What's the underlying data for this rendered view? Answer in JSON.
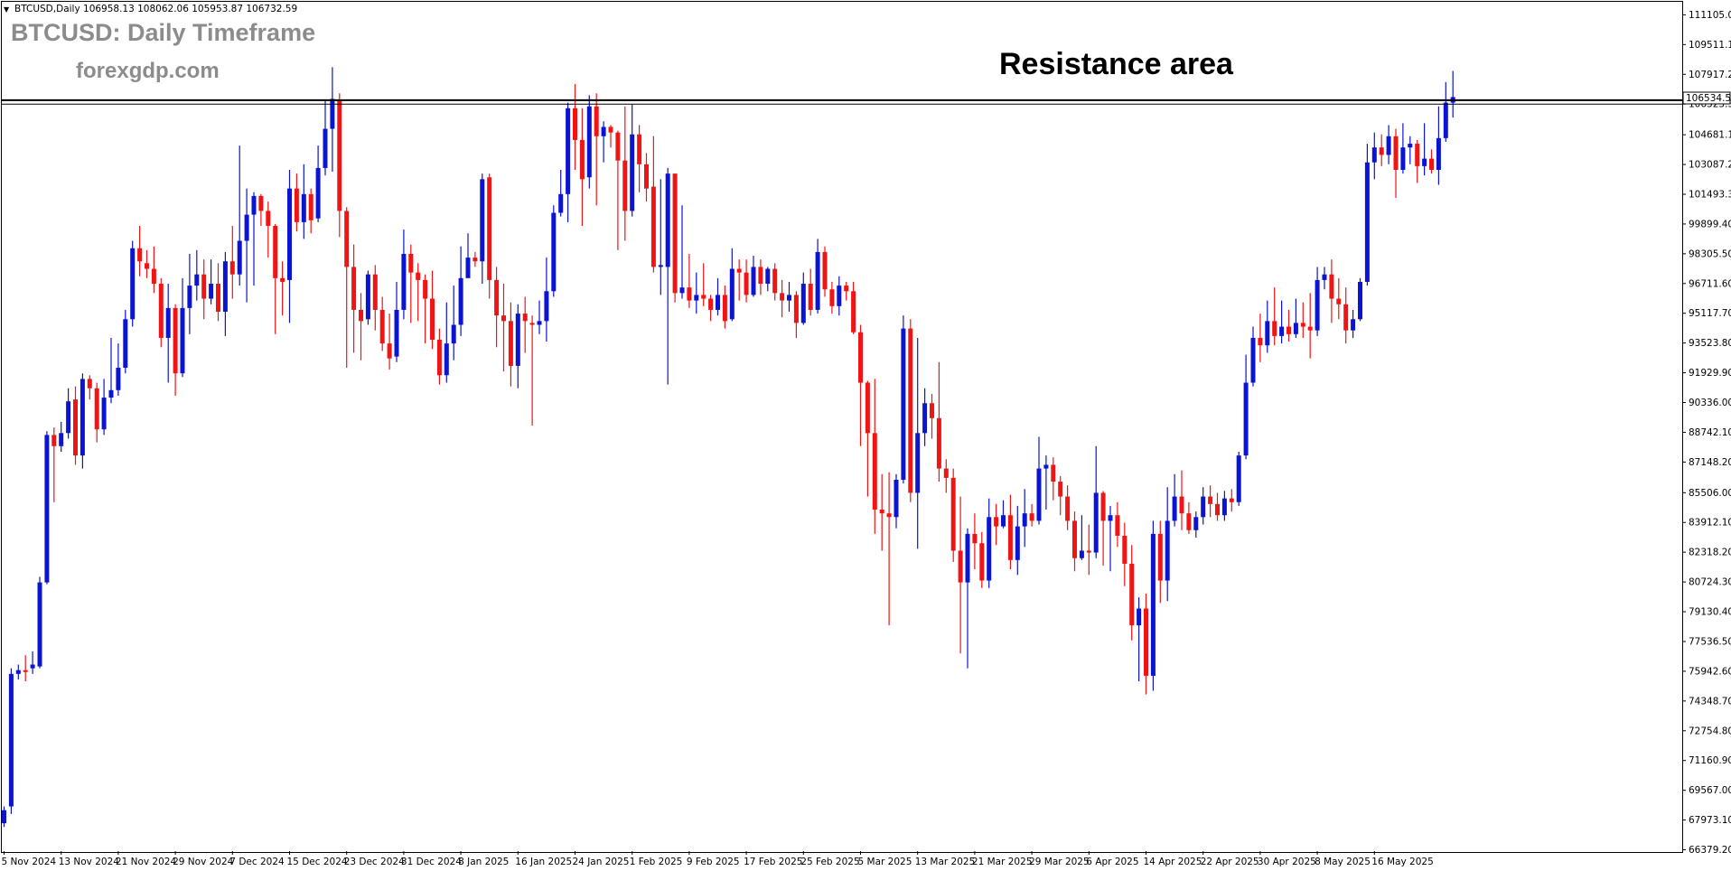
{
  "window": {
    "symbol_info": "BTCUSD,Daily  106958.13 108062.06 105953.87 106732.59",
    "dropdown_glyph": "▼"
  },
  "overlay": {
    "title": "BTCUSD: Daily Timeframe",
    "site": "forexgdp.com",
    "annotation": "Resistance area"
  },
  "colors": {
    "bull": "#0a14d2",
    "bear": "#f01414",
    "background": "#ffffff",
    "resistance_line": "#000000",
    "frame": "#000000"
  },
  "chart_data": {
    "type": "candlestick",
    "ylim": [
      66379.2,
      111105.0
    ],
    "y_ticks": [
      "111105.00",
      "109511.10",
      "107917.20",
      "106323.30",
      "104681.10",
      "103087.20",
      "101493.30",
      "99899.40",
      "98305.50",
      "96711.60",
      "95117.70",
      "93523.80",
      "91929.90",
      "90336.00",
      "88742.10",
      "87148.20",
      "85506.00",
      "83912.10",
      "82318.20",
      "80724.30",
      "79130.40",
      "77536.50",
      "75942.60",
      "74348.70",
      "72754.80",
      "71160.90",
      "69567.00",
      "67973.10",
      "66379.20"
    ],
    "x_labels": [
      "5 Nov 2024",
      "13 Nov 2024",
      "21 Nov 2024",
      "29 Nov 2024",
      "7 Dec 2024",
      "15 Dec 2024",
      "23 Dec 2024",
      "31 Dec 2024",
      "8 Jan 2025",
      "16 Jan 2025",
      "24 Jan 2025",
      "1 Feb 2025",
      "9 Feb 2025",
      "17 Feb 2025",
      "25 Feb 2025",
      "5 Mar 2025",
      "13 Mar 2025",
      "21 Mar 2025",
      "29 Mar 2025",
      "6 Apr 2025",
      "14 Apr 2025",
      "22 Apr 2025",
      "30 Apr 2025",
      "8 May 2025",
      "16 May 2025"
    ],
    "resistance_levels": [
      106534.52,
      106323.3
    ],
    "current_price": "106534.52",
    "candles": [
      [
        67800,
        68500,
        67600,
        68700
      ],
      [
        68700,
        75800,
        68300,
        76100
      ],
      [
        75800,
        76000,
        75500,
        76300
      ],
      [
        76000,
        75900,
        75400,
        76800
      ],
      [
        76100,
        76300,
        75800,
        77000
      ],
      [
        76200,
        80700,
        76100,
        81000
      ],
      [
        80700,
        88600,
        80600,
        88800
      ],
      [
        88600,
        88000,
        85000,
        89000
      ],
      [
        88000,
        88700,
        87700,
        89300
      ],
      [
        88700,
        90400,
        88400,
        91100
      ],
      [
        90500,
        87500,
        87000,
        91200
      ],
      [
        87500,
        91600,
        86800,
        91900
      ],
      [
        91600,
        91100,
        90500,
        91800
      ],
      [
        91100,
        88900,
        88200,
        91400
      ],
      [
        88900,
        90600,
        88600,
        91600
      ],
      [
        90600,
        91000,
        90300,
        93800
      ],
      [
        91000,
        92200,
        90700,
        93500
      ],
      [
        92200,
        94800,
        91900,
        95300
      ],
      [
        94800,
        98600,
        94400,
        99000
      ],
      [
        98600,
        97900,
        97100,
        99800
      ],
      [
        97800,
        97500,
        97000,
        98500
      ],
      [
        97500,
        96700,
        96200,
        98700
      ],
      [
        96700,
        93800,
        93300,
        97000
      ],
      [
        93800,
        95400,
        91400,
        96700
      ],
      [
        95400,
        91900,
        90700,
        95600
      ],
      [
        91900,
        95400,
        91700,
        97000
      ],
      [
        95400,
        96600,
        94000,
        98300
      ],
      [
        96600,
        97200,
        95800,
        98500
      ],
      [
        97200,
        95900,
        94800,
        98000
      ],
      [
        95900,
        96700,
        95600,
        98000
      ],
      [
        96700,
        95200,
        94700,
        97800
      ],
      [
        95200,
        97900,
        93900,
        98400
      ],
      [
        97900,
        97200,
        95900,
        99800
      ],
      [
        97200,
        99000,
        96600,
        104100
      ],
      [
        99000,
        100400,
        95700,
        101800
      ],
      [
        100400,
        101400,
        96600,
        101600
      ],
      [
        101400,
        100600,
        99800,
        101500
      ],
      [
        100600,
        99800,
        98100,
        101100
      ],
      [
        99800,
        97000,
        94000,
        99900
      ],
      [
        97000,
        96800,
        95000,
        97900
      ],
      [
        96900,
        101800,
        94600,
        102800
      ],
      [
        101800,
        100000,
        99500,
        102600
      ],
      [
        100000,
        101500,
        99100,
        103100
      ],
      [
        101500,
        100100,
        99400,
        101800
      ],
      [
        100200,
        102900,
        100000,
        104100
      ],
      [
        102900,
        105000,
        102500,
        106500
      ],
      [
        105000,
        106600,
        102700,
        108300
      ],
      [
        106500,
        100600,
        99200,
        106900
      ],
      [
        100600,
        97600,
        92200,
        100800
      ],
      [
        97600,
        95300,
        93000,
        98800
      ],
      [
        95300,
        94700,
        92600,
        96200
      ],
      [
        94800,
        97200,
        94500,
        97400
      ],
      [
        97200,
        95300,
        94200,
        97700
      ],
      [
        95300,
        93500,
        93100,
        96000
      ],
      [
        93500,
        92700,
        92100,
        95100
      ],
      [
        92800,
        95300,
        92500,
        96800
      ],
      [
        95300,
        98300,
        94800,
        99600
      ],
      [
        98300,
        97300,
        94600,
        98800
      ],
      [
        97300,
        96900,
        94700,
        97800
      ],
      [
        96900,
        95900,
        93500,
        97200
      ],
      [
        95900,
        93700,
        93200,
        97400
      ],
      [
        93700,
        91800,
        91300,
        94300
      ],
      [
        91800,
        93500,
        91400,
        95700
      ],
      [
        93500,
        94500,
        92600,
        96600
      ],
      [
        94500,
        97000,
        93900,
        98700
      ],
      [
        97000,
        98100,
        97200,
        99400
      ],
      [
        98100,
        97900,
        97600,
        98400
      ],
      [
        97900,
        102300,
        96700,
        102600
      ],
      [
        102400,
        96900,
        95900,
        102600
      ],
      [
        96900,
        95000,
        93300,
        97600
      ],
      [
        95000,
        94700,
        92000,
        96700
      ],
      [
        94700,
        92300,
        91200,
        95700
      ],
      [
        92300,
        95100,
        91100,
        95600
      ],
      [
        95100,
        94700,
        93000,
        96000
      ],
      [
        94600,
        94500,
        89100,
        95000
      ],
      [
        94500,
        94700,
        94000,
        95800
      ],
      [
        94700,
        96300,
        93600,
        98100
      ],
      [
        96300,
        100500,
        96000,
        100900
      ],
      [
        100500,
        101500,
        100300,
        102800
      ],
      [
        101500,
        106100,
        100000,
        106400
      ],
      [
        106100,
        104400,
        102800,
        107400
      ],
      [
        104400,
        102300,
        99800,
        106100
      ],
      [
        102400,
        106200,
        101800,
        106800
      ],
      [
        106200,
        104600,
        100900,
        106900
      ],
      [
        104600,
        105100,
        103200,
        105400
      ],
      [
        105100,
        104800,
        104000,
        105200
      ],
      [
        104800,
        103300,
        98500,
        104900
      ],
      [
        103300,
        100600,
        99000,
        106200
      ],
      [
        100600,
        104700,
        100300,
        106300
      ],
      [
        104700,
        103100,
        101600,
        105200
      ],
      [
        103100,
        101800,
        101100,
        103700
      ],
      [
        101900,
        97600,
        97300,
        104600
      ],
      [
        97600,
        97700,
        96100,
        102300
      ],
      [
        97600,
        102600,
        91300,
        102900
      ],
      [
        102600,
        96200,
        95700,
        102200
      ],
      [
        96200,
        96500,
        95900,
        100900
      ],
      [
        96500,
        95800,
        95400,
        98300
      ],
      [
        95800,
        96100,
        95100,
        97300
      ],
      [
        96100,
        95900,
        95500,
        97800
      ],
      [
        95900,
        95300,
        94700,
        96100
      ],
      [
        95300,
        96100,
        95000,
        97000
      ],
      [
        96100,
        94700,
        94300,
        96600
      ],
      [
        94800,
        97500,
        94700,
        98600
      ],
      [
        97500,
        97300,
        95800,
        98000
      ],
      [
        97300,
        96100,
        95700,
        98000
      ],
      [
        96100,
        97600,
        96000,
        98200
      ],
      [
        97600,
        96700,
        96100,
        98000
      ],
      [
        96700,
        97500,
        96300,
        97600
      ],
      [
        97500,
        96200,
        95800,
        97800
      ],
      [
        96200,
        95800,
        94900,
        96900
      ],
      [
        95800,
        96100,
        95200,
        96800
      ],
      [
        96100,
        94600,
        93800,
        96300
      ],
      [
        94600,
        96700,
        94500,
        97300
      ],
      [
        96700,
        95300,
        95000,
        97500
      ],
      [
        95300,
        98400,
        95100,
        99100
      ],
      [
        98400,
        96400,
        96000,
        98700
      ],
      [
        96400,
        95500,
        95100,
        96800
      ],
      [
        95500,
        96600,
        95000,
        97100
      ],
      [
        96600,
        96300,
        95800,
        96800
      ],
      [
        96300,
        94100,
        94000,
        96800
      ],
      [
        94100,
        91400,
        88000,
        94500
      ],
      [
        91400,
        88700,
        85300,
        91500
      ],
      [
        88700,
        84600,
        83300,
        91600
      ],
      [
        84600,
        84400,
        82400,
        86500
      ],
      [
        84400,
        84200,
        78400,
        86600
      ],
      [
        84200,
        86200,
        83600,
        86500
      ],
      [
        86200,
        94300,
        86000,
        95000
      ],
      [
        94300,
        85500,
        85000,
        94800
      ],
      [
        85500,
        88700,
        82500,
        93800
      ],
      [
        88700,
        90300,
        88000,
        91100
      ],
      [
        90300,
        89500,
        88400,
        90800
      ],
      [
        89500,
        86800,
        86100,
        92500
      ],
      [
        86800,
        86300,
        85500,
        87300
      ],
      [
        86300,
        82400,
        81800,
        86800
      ],
      [
        82400,
        80700,
        76900,
        85300
      ],
      [
        80700,
        83300,
        76100,
        83600
      ],
      [
        83300,
        82800,
        81400,
        84400
      ],
      [
        82800,
        80800,
        80400,
        83400
      ],
      [
        80800,
        84200,
        80400,
        85200
      ],
      [
        84200,
        83700,
        82700,
        84900
      ],
      [
        83700,
        84300,
        83600,
        85100
      ],
      [
        84300,
        81900,
        81400,
        85400
      ],
      [
        81900,
        83700,
        81100,
        84800
      ],
      [
        83700,
        84400,
        82600,
        85700
      ],
      [
        84400,
        84000,
        83700,
        84900
      ],
      [
        84000,
        86800,
        83800,
        88500
      ],
      [
        86800,
        87000,
        84600,
        87500
      ],
      [
        87000,
        86100,
        85100,
        87400
      ],
      [
        86100,
        85300,
        84300,
        86400
      ],
      [
        85300,
        84000,
        83500,
        85900
      ],
      [
        84000,
        82000,
        81300,
        84500
      ],
      [
        82000,
        82400,
        81900,
        84300
      ],
      [
        82400,
        82300,
        81100,
        83800
      ],
      [
        82300,
        85500,
        82000,
        88000
      ],
      [
        85500,
        84000,
        81600,
        85600
      ],
      [
        84000,
        84300,
        81300,
        84800
      ],
      [
        84300,
        83200,
        82600,
        85000
      ],
      [
        83200,
        81700,
        80500,
        83900
      ],
      [
        81700,
        78400,
        77600,
        82700
      ],
      [
        78400,
        79300,
        75400,
        79900
      ],
      [
        79300,
        75700,
        74700,
        80100
      ],
      [
        75700,
        83300,
        74900,
        84000
      ],
      [
        83300,
        80800,
        79600,
        84000
      ],
      [
        80800,
        84000,
        79700,
        85800
      ],
      [
        84000,
        85300,
        83700,
        86500
      ],
      [
        85300,
        84400,
        83500,
        86700
      ],
      [
        84400,
        83500,
        83300,
        85000
      ],
      [
        83500,
        84200,
        83100,
        84500
      ],
      [
        84200,
        85300,
        83800,
        85800
      ],
      [
        85300,
        84900,
        84200,
        85900
      ],
      [
        84900,
        84300,
        84000,
        85500
      ],
      [
        84300,
        85200,
        84000,
        85600
      ],
      [
        85200,
        85000,
        84500,
        85700
      ],
      [
        85000,
        87500,
        84800,
        87700
      ],
      [
        87500,
        91400,
        87300,
        92900
      ],
      [
        91400,
        93800,
        91200,
        94400
      ],
      [
        93800,
        93400,
        92500,
        95100
      ],
      [
        93400,
        94700,
        93000,
        95800
      ],
      [
        94700,
        93900,
        93400,
        96500
      ],
      [
        93900,
        94400,
        93500,
        95800
      ],
      [
        94400,
        94000,
        93600,
        95300
      ],
      [
        94000,
        94600,
        93800,
        95900
      ],
      [
        94600,
        94400,
        93800,
        95700
      ],
      [
        94400,
        94200,
        92700,
        96200
      ],
      [
        94200,
        96900,
        93900,
        97600
      ],
      [
        96900,
        97200,
        96400,
        97600
      ],
      [
        97200,
        95900,
        94600,
        98000
      ],
      [
        95900,
        95600,
        94800,
        97000
      ],
      [
        95600,
        94200,
        93500,
        96500
      ],
      [
        94200,
        94800,
        93800,
        95300
      ],
      [
        94800,
        96800,
        94700,
        97000
      ],
      [
        96800,
        103200,
        96600,
        104200
      ],
      [
        103200,
        104000,
        102300,
        104800
      ],
      [
        104000,
        103600,
        103000,
        104700
      ],
      [
        103600,
        104600,
        103100,
        105200
      ],
      [
        104600,
        102800,
        101300,
        105000
      ],
      [
        102800,
        104000,
        102600,
        105300
      ],
      [
        104000,
        104200,
        103100,
        104600
      ],
      [
        104200,
        103000,
        102100,
        104400
      ],
      [
        103000,
        103400,
        102500,
        105300
      ],
      [
        103400,
        102800,
        102600,
        103900
      ],
      [
        102800,
        104500,
        102000,
        106200
      ],
      [
        104500,
        106400,
        104300,
        107500
      ],
      [
        106400,
        106700,
        105600,
        108100
      ]
    ]
  }
}
